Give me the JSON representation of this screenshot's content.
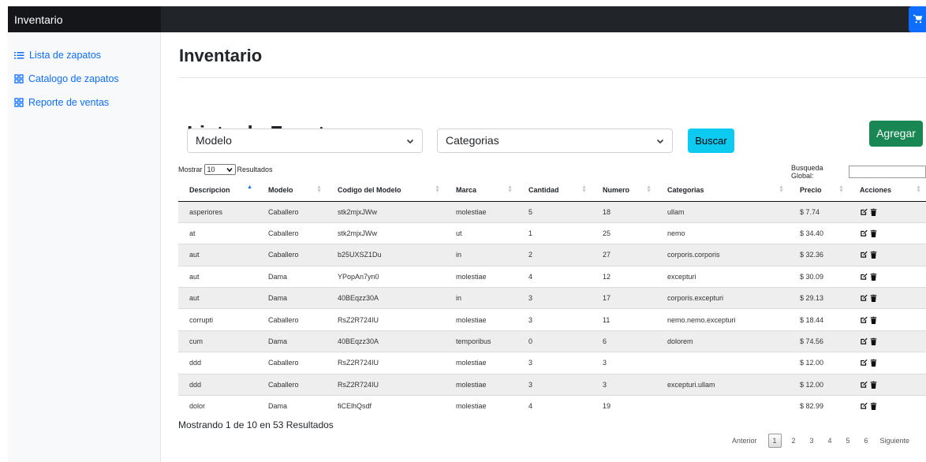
{
  "app": {
    "brand": "Inventario"
  },
  "sidebar": {
    "items": [
      {
        "label": "Lista de zapatos",
        "icon": "list-icon"
      },
      {
        "label": "Catalogo de zapatos",
        "icon": "grid-icon"
      },
      {
        "label": "Reporte de ventas",
        "icon": "grid-icon"
      }
    ]
  },
  "page": {
    "title": "Inventario"
  },
  "section": {
    "title": "Lista de Zapatos",
    "add_label": "Agregar",
    "model_select": "Modelo",
    "category_select": "Categorias",
    "search_label": "Buscar"
  },
  "datatable": {
    "show_prefix": "Mostrar",
    "show_value": "10",
    "show_suffix": "Resultados",
    "global_search_label": "Busqueda Global:",
    "columns": [
      "Descripcion",
      "Modelo",
      "Codigo del Modelo",
      "Marca",
      "Cantidad",
      "Numero",
      "Categorias",
      "Precio",
      "Acciones"
    ],
    "rows": [
      [
        "asperiores",
        "Caballero",
        "stk2mjxJWw",
        "molestiae",
        "5",
        "18",
        "ullam",
        "$ 7.74"
      ],
      [
        "at",
        "Caballero",
        "stk2mjxJWw",
        "ut",
        "1",
        "25",
        "nemo",
        "$ 34.40"
      ],
      [
        "aut",
        "Caballero",
        "b25UXSZ1Du",
        "in",
        "2",
        "27",
        "corporis.corporis",
        "$ 32.36"
      ],
      [
        "aut",
        "Dama",
        "YPopAn7yn0",
        "molestiae",
        "4",
        "12",
        "excepturi",
        "$ 30.09"
      ],
      [
        "aut",
        "Dama",
        "40BEqzz30A",
        "in",
        "3",
        "17",
        "corporis.excepturi",
        "$ 29.13"
      ],
      [
        "corrupti",
        "Caballero",
        "RsZ2R724IU",
        "molestiae",
        "3",
        "11",
        "nemo.nemo.excepturi",
        "$ 18.44"
      ],
      [
        "cum",
        "Dama",
        "40BEqzz30A",
        "temporibus",
        "0",
        "6",
        "dolorem",
        "$ 74.56"
      ],
      [
        "ddd",
        "Caballero",
        "RsZ2R724IU",
        "molestiae",
        "3",
        "3",
        "",
        "$ 12.00"
      ],
      [
        "ddd",
        "Caballero",
        "RsZ2R724IU",
        "molestiae",
        "3",
        "3",
        "excepturi.ullam",
        "$ 12.00"
      ],
      [
        "dolor",
        "Dama",
        "fiCElhQsdf",
        "molestiae",
        "4",
        "19",
        "",
        "$ 82.99"
      ]
    ],
    "info": "Mostrando 1 de 10 en 53 Resultados",
    "pager": {
      "prev": "Anterior",
      "pages": [
        "1",
        "2",
        "3",
        "4",
        "5",
        "6"
      ],
      "next": "Siguiente",
      "current": "1"
    }
  },
  "colors": {
    "primary": "#0d6efd",
    "success": "#198754",
    "info": "#0dcaf0",
    "navbar": "#212529"
  }
}
